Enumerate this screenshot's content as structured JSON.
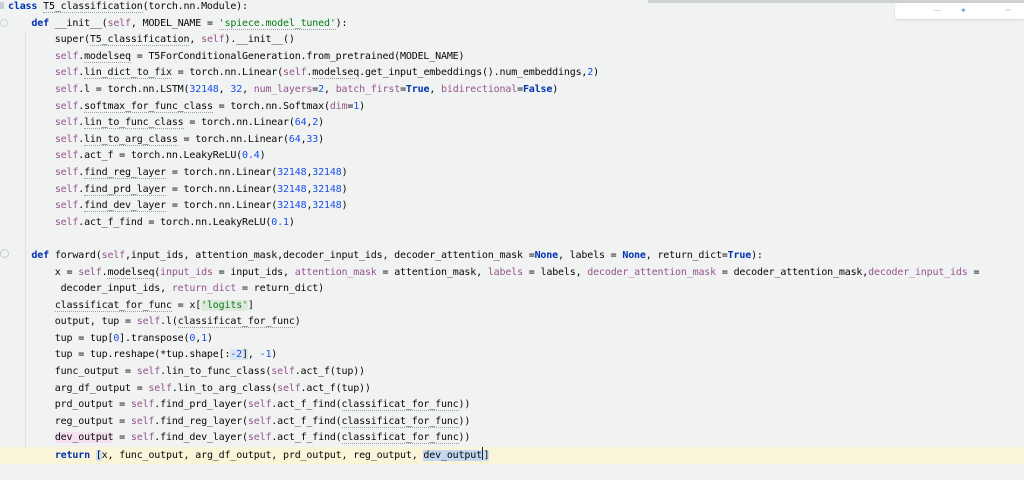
{
  "editor": {
    "background": "#f1f2f2",
    "current_line_color": "#faf4d9",
    "colors": {
      "keyword": "#0033b3",
      "number": "#1750eb",
      "string": "#067d17",
      "self_and_kwarg": "#94558d",
      "text": "#080808",
      "occurrence_write_bg": "#f5e0f0",
      "occurrence_read_bg": "#c3d7f1",
      "bracket_match_bg": "#c9def5",
      "string_highlight_bg": "#dee8dc"
    },
    "lines": [
      {
        "segs": [
          [
            "class ",
            "k"
          ],
          [
            "T5_classification",
            "du"
          ],
          [
            "(torch.nn.Module):",
            "d"
          ]
        ]
      },
      {
        "segs": [
          [
            "    ",
            "d"
          ],
          [
            "def ",
            "k"
          ],
          [
            "__init__",
            "d"
          ],
          [
            "(",
            "d"
          ],
          [
            "self",
            "p"
          ],
          [
            ", MODEL_NAME = ",
            "d"
          ],
          [
            "'spiece.model_tuned'",
            "su"
          ],
          [
            "):",
            "d"
          ]
        ]
      },
      {
        "segs": [
          [
            "        super(",
            "d"
          ],
          [
            "T5_classification",
            "du"
          ],
          [
            ", ",
            "d"
          ],
          [
            "self",
            "p"
          ],
          [
            ").__init__()",
            "d"
          ]
        ]
      },
      {
        "segs": [
          [
            "        ",
            "d"
          ],
          [
            "self",
            "p"
          ],
          [
            ".",
            "d"
          ],
          [
            "modelseq",
            "du"
          ],
          [
            " = T5ForConditionalGeneration.from_pretrained(MODEL_NAME)",
            "d"
          ]
        ]
      },
      {
        "segs": [
          [
            "        ",
            "d"
          ],
          [
            "self",
            "p"
          ],
          [
            ".",
            "d"
          ],
          [
            "lin_dict_to_fix",
            "du"
          ],
          [
            " = torch.nn.Linear(",
            "d"
          ],
          [
            "self",
            "p"
          ],
          [
            ".",
            "d"
          ],
          [
            "modelseq",
            "du"
          ],
          [
            ".get_input_embeddings().num_embeddings,",
            "d"
          ],
          [
            "2",
            "n"
          ],
          [
            ")",
            "d"
          ]
        ]
      },
      {
        "segs": [
          [
            "        ",
            "d"
          ],
          [
            "self",
            "p"
          ],
          [
            ".l = torch.nn.LSTM(",
            "d"
          ],
          [
            "32148",
            "n"
          ],
          [
            ", ",
            "d"
          ],
          [
            "32",
            "n"
          ],
          [
            ", ",
            "d"
          ],
          [
            "num_layers",
            "p"
          ],
          [
            "=",
            "d"
          ],
          [
            "2",
            "n"
          ],
          [
            ", ",
            "d"
          ],
          [
            "batch_first",
            "p"
          ],
          [
            "=",
            "d"
          ],
          [
            "True",
            "k"
          ],
          [
            ", ",
            "d"
          ],
          [
            "bidirectional",
            "p"
          ],
          [
            "=",
            "d"
          ],
          [
            "False",
            "k"
          ],
          [
            ")",
            "d"
          ]
        ]
      },
      {
        "segs": [
          [
            "        ",
            "d"
          ],
          [
            "self",
            "p"
          ],
          [
            ".",
            "d"
          ],
          [
            "softmax_for_func_class",
            "du"
          ],
          [
            " = torch.nn.Softmax(",
            "d"
          ],
          [
            "dim",
            "p"
          ],
          [
            "=",
            "d"
          ],
          [
            "1",
            "n"
          ],
          [
            ")",
            "d"
          ]
        ]
      },
      {
        "segs": [
          [
            "        ",
            "d"
          ],
          [
            "self",
            "p"
          ],
          [
            ".",
            "d"
          ],
          [
            "lin_to_func_class",
            "du"
          ],
          [
            " = torch.nn.Linear(",
            "d"
          ],
          [
            "64",
            "n"
          ],
          [
            ",",
            "d"
          ],
          [
            "2",
            "n"
          ],
          [
            ")",
            "d"
          ]
        ]
      },
      {
        "segs": [
          [
            "        ",
            "d"
          ],
          [
            "self",
            "p"
          ],
          [
            ".",
            "d"
          ],
          [
            "lin_to_arg_class",
            "du"
          ],
          [
            " = torch.nn.Linear(",
            "d"
          ],
          [
            "64",
            "n"
          ],
          [
            ",",
            "d"
          ],
          [
            "33",
            "n"
          ],
          [
            ")",
            "d"
          ]
        ]
      },
      {
        "segs": [
          [
            "        ",
            "d"
          ],
          [
            "self",
            "p"
          ],
          [
            ".act_f = torch.nn.LeakyReLU(",
            "d"
          ],
          [
            "0.4",
            "n"
          ],
          [
            ")",
            "d"
          ]
        ]
      },
      {
        "segs": [
          [
            "        ",
            "d"
          ],
          [
            "self",
            "p"
          ],
          [
            ".",
            "d"
          ],
          [
            "find_reg_layer",
            "du"
          ],
          [
            " = torch.nn.Linear(",
            "d"
          ],
          [
            "32148",
            "n"
          ],
          [
            ",",
            "d"
          ],
          [
            "32148",
            "n"
          ],
          [
            ")",
            "d"
          ]
        ]
      },
      {
        "segs": [
          [
            "        ",
            "d"
          ],
          [
            "self",
            "p"
          ],
          [
            ".",
            "d"
          ],
          [
            "find_prd_layer",
            "du"
          ],
          [
            " = torch.nn.Linear(",
            "d"
          ],
          [
            "32148",
            "n"
          ],
          [
            ",",
            "d"
          ],
          [
            "32148",
            "n"
          ],
          [
            ")",
            "d"
          ]
        ]
      },
      {
        "segs": [
          [
            "        ",
            "d"
          ],
          [
            "self",
            "p"
          ],
          [
            ".",
            "d"
          ],
          [
            "find_dev_layer",
            "du"
          ],
          [
            " = torch.nn.Linear(",
            "d"
          ],
          [
            "32148",
            "n"
          ],
          [
            ",",
            "d"
          ],
          [
            "32148",
            "n"
          ],
          [
            ")",
            "d"
          ]
        ]
      },
      {
        "segs": [
          [
            "        ",
            "d"
          ],
          [
            "self",
            "p"
          ],
          [
            ".act_f_find = torch.nn.LeakyReLU(",
            "d"
          ],
          [
            "0.1",
            "n"
          ],
          [
            ")",
            "d"
          ]
        ]
      },
      {
        "segs": [
          [
            "",
            "d"
          ]
        ]
      },
      {
        "segs": [
          [
            "    ",
            "d"
          ],
          [
            "def ",
            "k"
          ],
          [
            "forward(",
            "d"
          ],
          [
            "self",
            "p"
          ],
          [
            ",input_ids, attention_mask,decoder_input_ids, decoder_attention_mask =",
            "d"
          ],
          [
            "None",
            "k"
          ],
          [
            ", labels = ",
            "d"
          ],
          [
            "None",
            "k"
          ],
          [
            ", return_dict=",
            "d"
          ],
          [
            "True",
            "k"
          ],
          [
            "):",
            "d"
          ]
        ]
      },
      {
        "segs": [
          [
            "        x = ",
            "d"
          ],
          [
            "self",
            "p"
          ],
          [
            ".",
            "d"
          ],
          [
            "modelseq",
            "du"
          ],
          [
            "(",
            "d"
          ],
          [
            "input_ids",
            "p"
          ],
          [
            " = input_ids, ",
            "d"
          ],
          [
            "attention_mask",
            "p"
          ],
          [
            " = attention_mask, ",
            "d"
          ],
          [
            "labels",
            "p"
          ],
          [
            " = labels, ",
            "d"
          ],
          [
            "decoder_attention_mask",
            "p"
          ],
          [
            " = decoder_attention_mask,",
            "d"
          ],
          [
            "decoder_input_ids",
            "p"
          ],
          [
            " =",
            "d"
          ]
        ]
      },
      {
        "segs": [
          [
            "         decoder_input_ids, ",
            "d"
          ],
          [
            "return_dict",
            "p"
          ],
          [
            " = return_dict)",
            "d"
          ]
        ]
      },
      {
        "segs": [
          [
            "        ",
            "d"
          ],
          [
            "classificat_for_func",
            "du"
          ],
          [
            " = x[",
            "d"
          ],
          [
            "'logits'",
            "sh"
          ],
          [
            "]",
            "d"
          ]
        ]
      },
      {
        "segs": [
          [
            "        output, tup = ",
            "d"
          ],
          [
            "self",
            "p"
          ],
          [
            ".l(",
            "d"
          ],
          [
            "classificat_for_func",
            "du"
          ],
          [
            ")",
            "d"
          ]
        ]
      },
      {
        "segs": [
          [
            "        tup = tup[",
            "d"
          ],
          [
            "0",
            "n"
          ],
          [
            "].transpose(",
            "d"
          ],
          [
            "0",
            "n"
          ],
          [
            ",",
            "d"
          ],
          [
            "1",
            "n"
          ],
          [
            ")",
            "d"
          ]
        ]
      },
      {
        "segs": [
          [
            "        tup = tup.reshape(*tup.shape[:",
            "d"
          ],
          [
            "-2",
            "nsel"
          ],
          [
            "]",
            "dsel"
          ],
          [
            ", ",
            "d"
          ],
          [
            "-1",
            "n"
          ],
          [
            ")",
            "d"
          ]
        ]
      },
      {
        "segs": [
          [
            "        func_output = ",
            "d"
          ],
          [
            "self",
            "p"
          ],
          [
            ".lin_to_func_class(",
            "d"
          ],
          [
            "self",
            "p"
          ],
          [
            ".act_f(tup))",
            "d"
          ]
        ]
      },
      {
        "segs": [
          [
            "        arg_df_output = ",
            "d"
          ],
          [
            "self",
            "p"
          ],
          [
            ".lin_to_arg_class(",
            "d"
          ],
          [
            "self",
            "p"
          ],
          [
            ".act_f(tup))",
            "d"
          ]
        ]
      },
      {
        "segs": [
          [
            "        prd_output = ",
            "d"
          ],
          [
            "self",
            "p"
          ],
          [
            ".find_prd_layer(",
            "d"
          ],
          [
            "self",
            "p"
          ],
          [
            ".act_f_find(",
            "d"
          ],
          [
            "classificat_for_func",
            "du"
          ],
          [
            "))",
            "d"
          ]
        ]
      },
      {
        "segs": [
          [
            "        reg_output = ",
            "d"
          ],
          [
            "self",
            "p"
          ],
          [
            ".find_reg_layer(",
            "d"
          ],
          [
            "self",
            "p"
          ],
          [
            ".act_f_find(",
            "d"
          ],
          [
            "classificat_for_func",
            "du"
          ],
          [
            "))",
            "d"
          ]
        ]
      },
      {
        "segs": [
          [
            "        ",
            "d"
          ],
          [
            "dev_output",
            "occ"
          ],
          [
            " = ",
            "d"
          ],
          [
            "self",
            "p"
          ],
          [
            ".find_dev_layer(",
            "d"
          ],
          [
            "self",
            "p"
          ],
          [
            ".act_f_find(",
            "d"
          ],
          [
            "classificat_for_func",
            "du"
          ],
          [
            "))",
            "d"
          ]
        ]
      },
      {
        "current": true,
        "segs": [
          [
            "        ",
            "d"
          ],
          [
            "return ",
            "k"
          ],
          [
            "[",
            "br"
          ],
          [
            "x, func_output, arg_df_output, prd_output, reg_output, ",
            "d"
          ],
          [
            "dev_output",
            "sel"
          ],
          [
            "",
            "caret"
          ],
          [
            "]",
            "br"
          ]
        ]
      }
    ]
  },
  "overlay": {
    "icons": [
      {
        "name": "more",
        "glyph": "⋯"
      },
      {
        "name": "edit",
        "glyph": "✦"
      },
      {
        "name": "expand",
        "glyph": "⌐"
      }
    ]
  }
}
